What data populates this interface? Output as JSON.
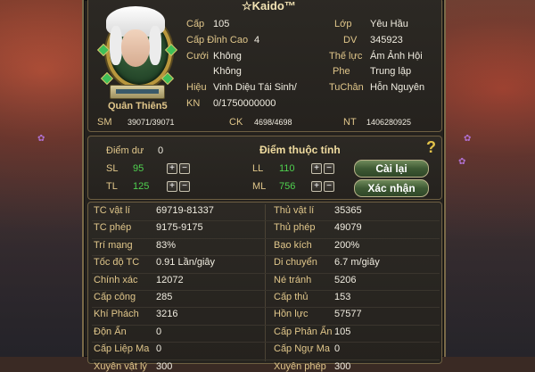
{
  "header": {
    "name": "☆Kaido™"
  },
  "character": {
    "rank_name": "Quân Thiên5",
    "fields": [
      {
        "label": "Cấp",
        "value": "105"
      },
      {
        "label": "Cấp Đỉnh Cao",
        "value": "4"
      },
      {
        "label": "Cưới",
        "value": "Không"
      },
      {
        "label": "",
        "value": "Không"
      },
      {
        "label": "Hiệu",
        "value": "Vinh Diệu Tái Sinh/"
      },
      {
        "label": "KN",
        "value": "0/1750000000"
      }
    ],
    "right_fields": [
      {
        "label": "Lớp",
        "value": "Yêu Hầu"
      },
      {
        "label": "DV",
        "value": "345923"
      },
      {
        "label": "Thế lực",
        "value": "Ám Ảnh Hội"
      },
      {
        "label": "Phe",
        "value": "Trung lập"
      },
      {
        "label": "TuChân",
        "value": "Hỗn Nguyên"
      }
    ],
    "sm": {
      "label": "SM",
      "value": "39071/39071"
    },
    "ck": {
      "label": "CK",
      "value": "4698/4698"
    },
    "nt": {
      "label": "NT",
      "value": "1406280925"
    }
  },
  "attributes": {
    "title": "Điểm thuộc tính",
    "free_points_label": "Điểm dư",
    "free_points_value": "0",
    "sl": {
      "label": "SL",
      "value": "95"
    },
    "tl": {
      "label": "TL",
      "value": "125"
    },
    "ll": {
      "label": "LL",
      "value": "110"
    },
    "ml": {
      "label": "ML",
      "value": "756"
    },
    "reset_label": "Cài lại",
    "confirm_label": "Xác nhận",
    "plus": "+",
    "minus": "−",
    "help": "?"
  },
  "stats": {
    "left": [
      {
        "label": "TC vật lí",
        "value": "69719-81337"
      },
      {
        "label": "TC phép",
        "value": "9175-9175"
      },
      {
        "label": "Trí mạng",
        "value": "83%"
      },
      {
        "label": "Tốc độ TC",
        "value": "0.91 Lần/giây"
      },
      {
        "label": "Chính xác",
        "value": "12072"
      },
      {
        "label": "Cấp công",
        "value": "285"
      },
      {
        "label": "Khí Phách",
        "value": "3216"
      },
      {
        "label": "Độn Ẩn",
        "value": "0"
      },
      {
        "label": "Cấp Liệp Ma",
        "value": "0"
      },
      {
        "label": "Xuyên vật lý",
        "value": "300"
      }
    ],
    "right": [
      {
        "label": "Thủ vật lí",
        "value": "35365"
      },
      {
        "label": "Thủ phép",
        "value": "49079"
      },
      {
        "label": "Bạo kích",
        "value": "200%"
      },
      {
        "label": "Di chuyển",
        "value": "6.7 m/giây"
      },
      {
        "label": "Né tránh",
        "value": "5206"
      },
      {
        "label": "Cấp thủ",
        "value": "153"
      },
      {
        "label": "Hồn lực",
        "value": "57577"
      },
      {
        "label": "Cấp Phản Ẩn",
        "value": "105"
      },
      {
        "label": "Cấp Ngự Ma",
        "value": "0"
      },
      {
        "label": "Xuyên phép",
        "value": "300"
      }
    ]
  },
  "colors": {
    "accent": "#e0c68a",
    "positive": "#4fd14f",
    "panel": "#24211d",
    "border": "#7a6a48"
  }
}
